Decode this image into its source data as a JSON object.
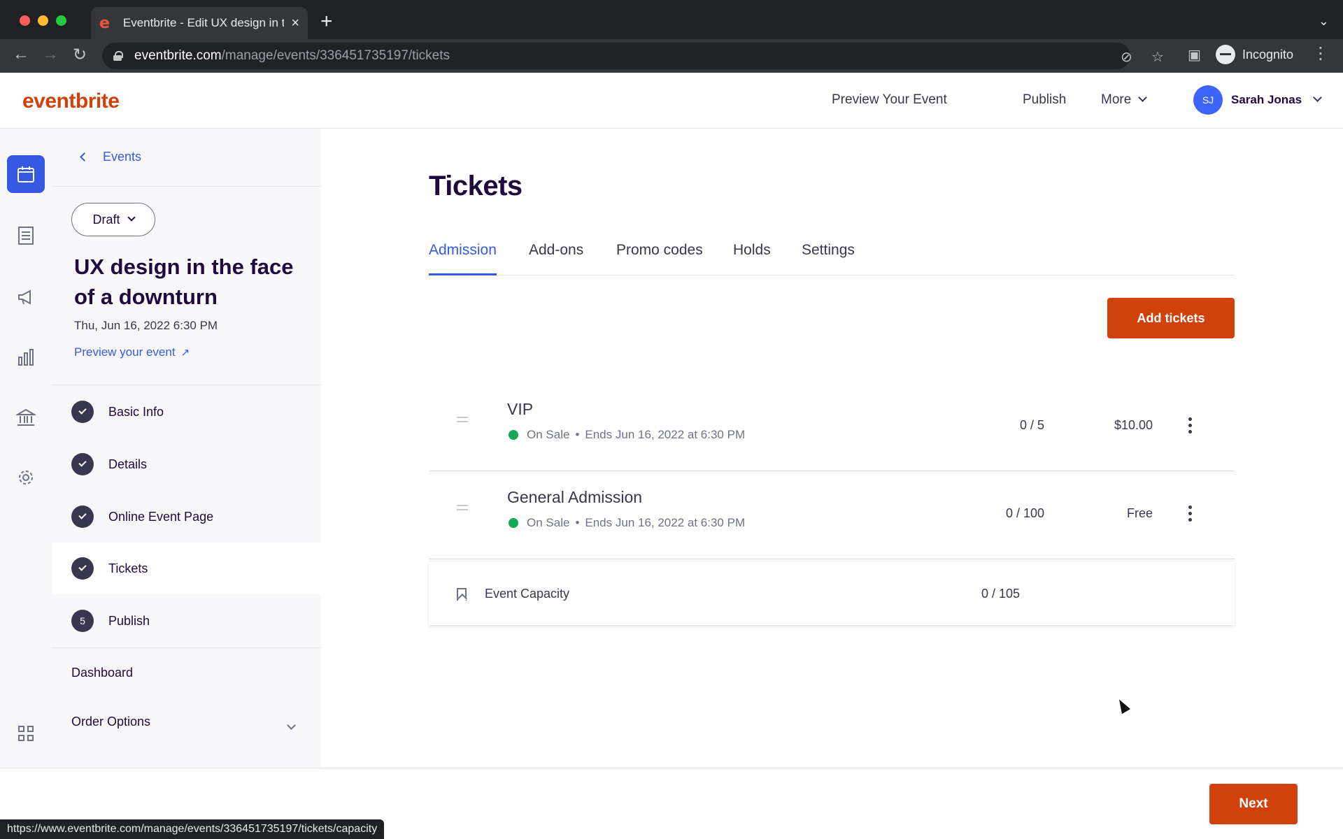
{
  "browser": {
    "tab_title": "Eventbrite - Edit UX design in t",
    "tab_favicon": "e",
    "url_host": "eventbrite.com",
    "url_path": "/manage/events/336451735197/tickets",
    "profile_label": "Incognito",
    "status_url": "https://www.eventbrite.com/manage/events/336451735197/tickets/capacity"
  },
  "header": {
    "logo": "eventbrite",
    "preview_label": "Preview Your Event",
    "publish_label": "Publish",
    "more_label": "More",
    "user_initials": "SJ",
    "user_name": "Sarah Jonas"
  },
  "sidebar": {
    "back_label": "Events",
    "status": "Draft",
    "event_title": "UX design in the face of a downturn",
    "event_date": "Thu, Jun 16, 2022 6:30 PM",
    "preview_link": "Preview your event",
    "steps": [
      {
        "label": "Basic Info",
        "badge": "check"
      },
      {
        "label": "Details",
        "badge": "check"
      },
      {
        "label": "Online Event Page",
        "badge": "check"
      },
      {
        "label": "Tickets",
        "badge": "check"
      },
      {
        "label": "Publish",
        "badge": "5"
      }
    ],
    "dashboard_label": "Dashboard",
    "order_options_label": "Order Options"
  },
  "rail_icons": [
    "calendar-icon",
    "list-icon",
    "megaphone-icon",
    "bar-chart-icon",
    "bank-icon",
    "gear-icon",
    "apps-grid-icon"
  ],
  "main": {
    "title": "Tickets",
    "tabs": [
      {
        "label": "Admission"
      },
      {
        "label": "Add-ons"
      },
      {
        "label": "Promo codes"
      },
      {
        "label": "Holds"
      },
      {
        "label": "Settings"
      }
    ],
    "add_button": "Add tickets",
    "tickets": [
      {
        "name": "VIP",
        "status": "On Sale",
        "ends": "Ends Jun 16, 2022 at 6:30 PM",
        "count": "0 / 5",
        "price": "$10.00"
      },
      {
        "name": "General Admission",
        "status": "On Sale",
        "ends": "Ends Jun 16, 2022 at 6:30 PM",
        "count": "0 / 100",
        "price": "Free"
      }
    ],
    "capacity_label": "Event Capacity",
    "capacity_value": "0 / 105"
  },
  "footer": {
    "next_label": "Next"
  },
  "colors": {
    "brand": "#d1410c",
    "accent": "#3659e3",
    "on_sale": "#14a956"
  }
}
